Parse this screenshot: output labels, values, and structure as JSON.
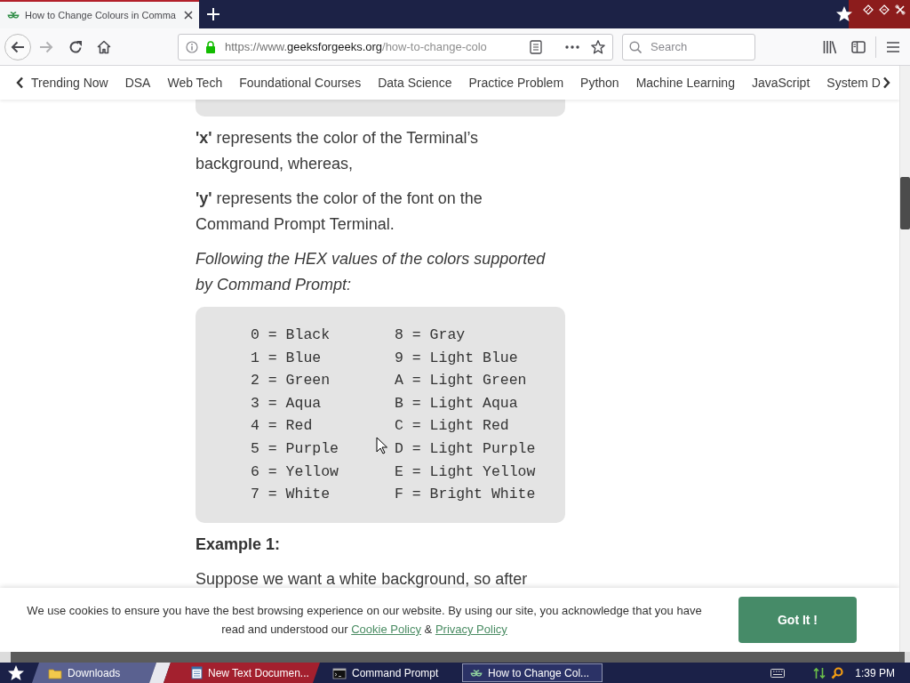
{
  "browser": {
    "tabs": [
      {
        "title": "How to Change Colours in Comma",
        "selected": true
      }
    ],
    "address_bar": {
      "prefix": "https://www.",
      "domain": "geeksforgeeks.org",
      "path": "/how-to-change-colo"
    },
    "search": {
      "placeholder": "Search"
    }
  },
  "site_nav": {
    "items": [
      "Trending Now",
      "DSA",
      "Web Tech",
      "Foundational Courses",
      "Data Science",
      "Practice Problem",
      "Python",
      "Machine Learning",
      "JavaScript",
      "System D"
    ]
  },
  "article": {
    "blocks": [
      {
        "kind": "text",
        "text": "**'x'** represents the color of the Terminal’s background, whereas,"
      },
      {
        "kind": "text",
        "text": "**'y'** represents the color of the font on the Command Prompt Terminal."
      },
      {
        "kind": "italic",
        "text": "Following the HEX values of the colors supported by Command Prompt:"
      },
      {
        "kind": "code",
        "rows": [
          [
            "0 = Black",
            "8 = Gray"
          ],
          [
            "1 = Blue",
            "9 = Light Blue"
          ],
          [
            "2 = Green",
            "A = Light Green"
          ],
          [
            "3 = Aqua",
            "B = Light Aqua"
          ],
          [
            "4 = Red",
            "C = Light Red"
          ],
          [
            "5 = Purple",
            "D = Light Purple"
          ],
          [
            "6 = Yellow",
            "E = Light Yellow"
          ],
          [
            "7 = White",
            "F = Bright White"
          ]
        ]
      },
      {
        "kind": "heading",
        "text": "Example 1:"
      },
      {
        "kind": "text",
        "text": "Suppose we want a white background, so after"
      }
    ]
  },
  "cookie_banner": {
    "text": "We use cookies to ensure you have the best browsing experience on our website. By using our site, you acknowledge that you have read and understood our",
    "links": [
      "Cookie Policy",
      "Privacy Policy"
    ],
    "joiner": "&",
    "button": "Got It !"
  },
  "taskbar": {
    "items": [
      {
        "kind": "folder",
        "label": "Downloads",
        "selected": false
      },
      {
        "kind": "document",
        "label": "New Text Documen...",
        "selected": false
      },
      {
        "kind": "console",
        "label": "Command Prompt",
        "selected": false
      },
      {
        "kind": "browser",
        "label": "How to Change Col...",
        "selected": true
      }
    ],
    "clock": "1:39 PM"
  }
}
